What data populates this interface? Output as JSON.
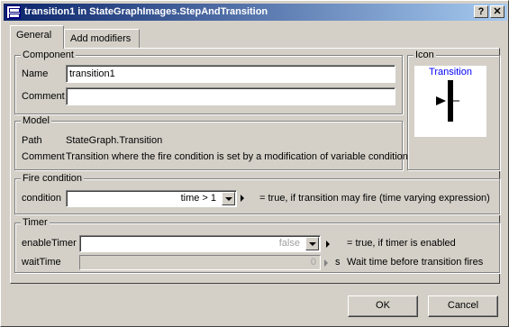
{
  "window": {
    "title": "transition1 in StateGraphImages.StepAndTransition",
    "help_label": "?",
    "close_label": "✕"
  },
  "tabs": [
    {
      "label": "General",
      "active": true
    },
    {
      "label": "Add modifiers",
      "active": false
    }
  ],
  "component": {
    "legend": "Component",
    "name_label": "Name",
    "name_value": "transition1",
    "comment_label": "Comment",
    "comment_value": ""
  },
  "icon": {
    "legend": "Icon",
    "caption": "Transition"
  },
  "model": {
    "legend": "Model",
    "path_label": "Path",
    "path_value": "StateGraph.Transition",
    "comment_label": "Comment",
    "comment_value": "Transition where the fire condition is set by a modification of variable condition"
  },
  "fire_condition": {
    "legend": "Fire condition",
    "condition_label": "condition",
    "condition_value": "time > 1",
    "condition_desc": "= true, if transition may fire (time varying expression)"
  },
  "timer": {
    "legend": "Timer",
    "enable_label": "enableTimer",
    "enable_value": "false",
    "enable_desc": "= true, if timer is enabled",
    "wait_label": "waitTime",
    "wait_value": "0",
    "wait_unit": "s",
    "wait_desc": "Wait time before transition fires"
  },
  "buttons": {
    "ok": "OK",
    "cancel": "Cancel"
  },
  "colors": {
    "face": "#d4d0c8",
    "title_start": "#0a246a",
    "title_end": "#a6caf0",
    "icon_caption": "#0000ff"
  }
}
